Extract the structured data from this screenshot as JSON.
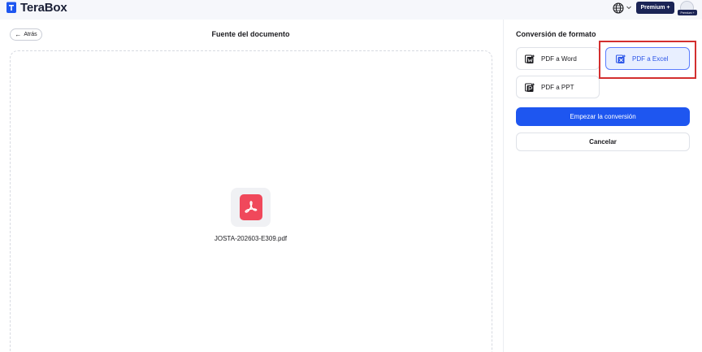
{
  "app": {
    "name": "TeraBox"
  },
  "header": {
    "premium_label": "Premium +",
    "avatar_badge": "Premium +",
    "language_icon": "globe-icon"
  },
  "document": {
    "back_label": "Atrás",
    "title": "Fuente del documento",
    "file_name": "JOSTA-202603-E309.pdf",
    "file_icon": "pdf-file-icon"
  },
  "conversion": {
    "title": "Conversión de formato",
    "options": [
      {
        "label": "PDF a Word",
        "icon": "pdf-to-word-icon",
        "selected": false
      },
      {
        "label": "PDF a Excel",
        "icon": "pdf-to-excel-icon",
        "selected": true
      },
      {
        "label": "PDF a PPT",
        "icon": "pdf-to-ppt-icon",
        "selected": false
      }
    ],
    "start_label": "Empezar la conversión",
    "cancel_label": "Cancelar"
  },
  "colors": {
    "brand_dark": "#1b2456",
    "primary": "#1e56f0",
    "selected_bg": "#e8efff",
    "pdf_red": "#f0485b",
    "highlight": "#d32f2f"
  }
}
